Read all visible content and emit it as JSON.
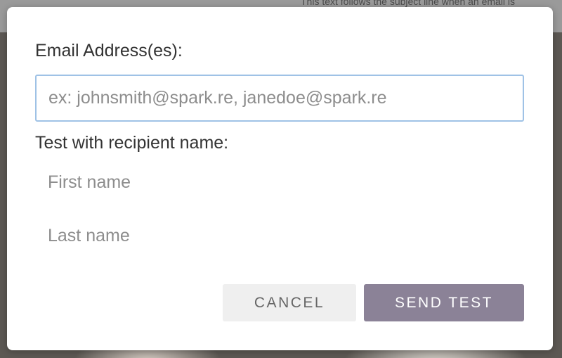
{
  "background": {
    "hint_text": "This text follows the subject line when an email is"
  },
  "modal": {
    "email_label": "Email Address(es):",
    "email_placeholder": "ex: johnsmith@spark.re, janedoe@spark.re",
    "email_value": "",
    "recipient_label": "Test with recipient name:",
    "first_name_placeholder": "First name",
    "first_name_value": "",
    "last_name_placeholder": "Last name",
    "last_name_value": "",
    "cancel_label": "CANCEL",
    "send_label": "SEND TEST"
  },
  "colors": {
    "send_button": "#8b8297",
    "cancel_button": "#efefef",
    "input_focus_border": "#9fc2e6"
  }
}
